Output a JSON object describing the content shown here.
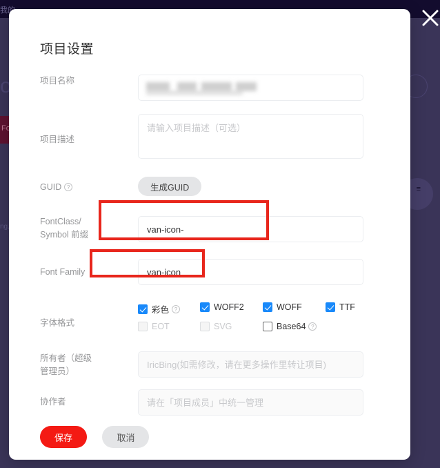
{
  "background": {
    "topbar_text": "我的",
    "logo_text": "ol",
    "band_text": "Fo",
    "side_text": "ng.",
    "close_icon": "close-icon"
  },
  "modal": {
    "title": "项目设置",
    "rows": {
      "project_name": {
        "label": "项目名称",
        "value": "",
        "redacted": true
      },
      "project_desc": {
        "label": "项目描述",
        "placeholder": "请输入项目描述（可选）",
        "value": ""
      },
      "guid": {
        "label": "GUID",
        "help_icon": "question-icon",
        "button_label": "生成GUID"
      },
      "fontclass": {
        "label": "FontClass/\nSymbol 前缀",
        "label_line1": "FontClass/",
        "label_line2": "Symbol 前缀",
        "value": "van-icon-"
      },
      "font_family": {
        "label": "Font Family",
        "value": "van-icon"
      },
      "font_format": {
        "label": "字体格式",
        "options": [
          {
            "label": "彩色",
            "checked": true,
            "disabled": false,
            "help": true
          },
          {
            "label": "WOFF2",
            "checked": true,
            "disabled": false,
            "help": false
          },
          {
            "label": "WOFF",
            "checked": true,
            "disabled": false,
            "help": false
          },
          {
            "label": "TTF",
            "checked": true,
            "disabled": false,
            "help": false
          },
          {
            "label": "EOT",
            "checked": false,
            "disabled": true,
            "help": false
          },
          {
            "label": "SVG",
            "checked": false,
            "disabled": true,
            "help": false
          },
          {
            "label": "Base64",
            "checked": false,
            "disabled": false,
            "help": true
          }
        ]
      },
      "owner": {
        "label_line1": "所有者（超级",
        "label_line2": "管理员）",
        "placeholder": "IricBing(如需修改，请在更多操作里转让项目)",
        "value": ""
      },
      "collaborator": {
        "label": "协作者",
        "placeholder": "请在「项目成员」中统一管理",
        "value": ""
      }
    },
    "footer": {
      "save_label": "保存",
      "cancel_label": "取消"
    }
  },
  "colors": {
    "accent_red": "#f41a14",
    "checkbox_blue": "#1989fa",
    "annotation_red": "#e8261c",
    "backdrop_purple": "#3a3458",
    "topbar_navy": "#130c2e"
  }
}
